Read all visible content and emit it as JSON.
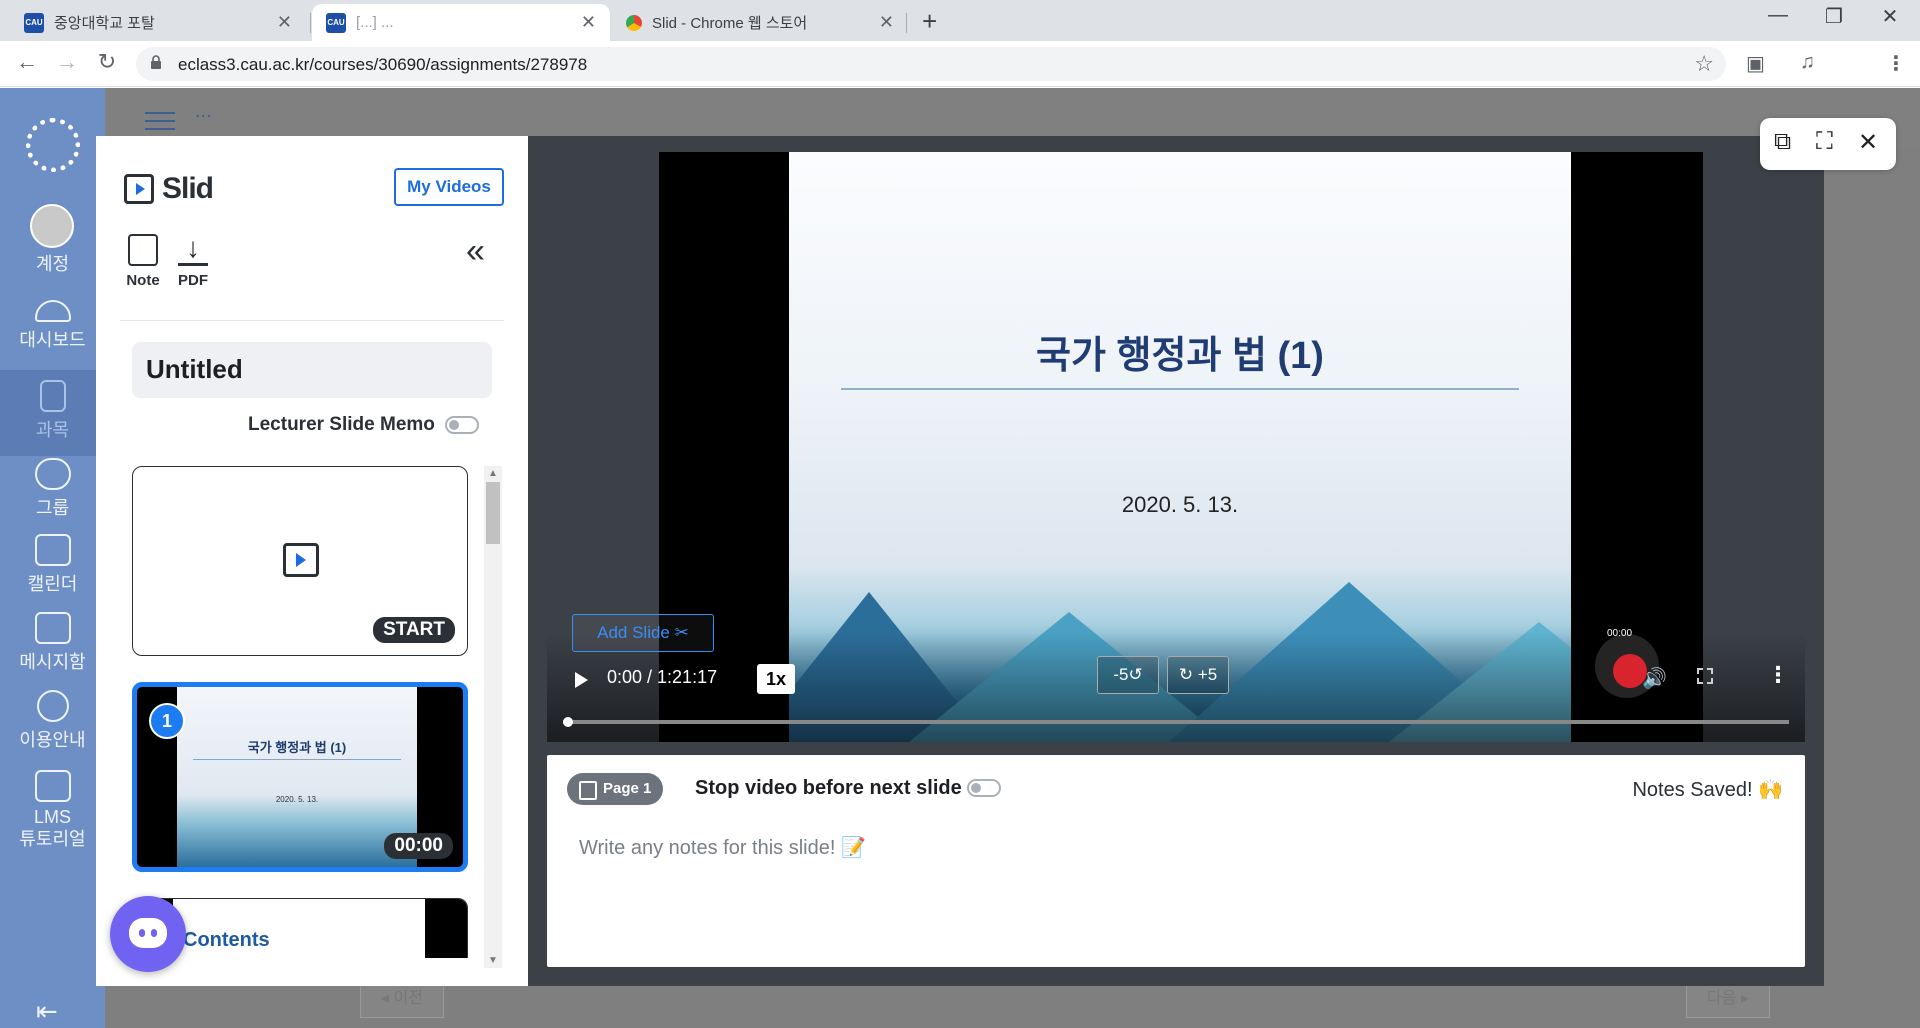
{
  "browser": {
    "tabs": [
      {
        "title": "중앙대학교 포탈",
        "favicon": "CAU"
      },
      {
        "title": "[...] ...",
        "favicon": "CAU"
      },
      {
        "title": "Slid - Chrome 웹 스토어",
        "favicon": "store"
      }
    ],
    "url": "eclass3.cau.ac.kr/courses/30690/assignments/278978"
  },
  "lms": {
    "nav": [
      {
        "label": "계정"
      },
      {
        "label": "대시보드"
      },
      {
        "label": "과목"
      },
      {
        "label": "그룹"
      },
      {
        "label": "캘린더"
      },
      {
        "label": "메시지함"
      },
      {
        "label": "이용안내"
      },
      {
        "label": "LMS\n튜토리얼"
      }
    ],
    "breadcrumb": "...",
    "prev_label": "◂ 이전",
    "next_label": "다음 ▸"
  },
  "slid": {
    "brand": "Slid",
    "my_videos": "My Videos",
    "tools": {
      "note": "Note",
      "pdf": "PDF"
    },
    "doc_title": "Untitled",
    "lecturer_memo": "Lecturer Slide Memo",
    "start_label": "START",
    "slide1": {
      "number": "1",
      "time": "00:00",
      "title": "국가 행정과 법 (1)",
      "date": "2020. 5. 13."
    },
    "slide2": {
      "text": "Contents"
    }
  },
  "player": {
    "slide_title": "국가 행정과 법 (1)",
    "slide_date": "2020. 5. 13.",
    "add_slide": "Add Slide",
    "time": "0:00 / 1:21:17",
    "speed": "1x",
    "back": "-5",
    "forward": "+5",
    "rec_time": "00:00",
    "progress": 0
  },
  "notes": {
    "page_chip": "Page 1",
    "stop_label": "Stop video before next slide",
    "saved": "Notes Saved!",
    "saved_emoji": "🙌",
    "placeholder": "Write any notes for this slide! 📝"
  }
}
